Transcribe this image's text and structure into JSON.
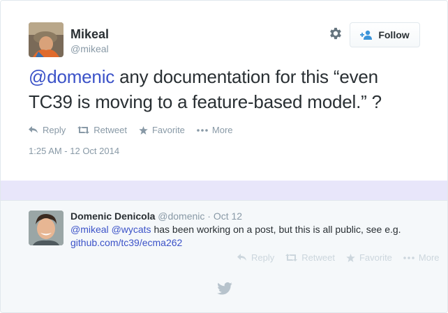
{
  "tweet": {
    "author_name": "Mikeal",
    "author_handle": "@mikeal",
    "follow_label": "Follow",
    "text_mention": "@domenic",
    "text_body": " any documentation for this “even TC39 is moving to a feature-based model.” ?",
    "actions": {
      "reply": "Reply",
      "retweet": "Retweet",
      "favorite": "Favorite",
      "more": "More"
    },
    "timestamp": "1:25 AM - 12 Oct 2014"
  },
  "reply": {
    "author_name": "Domenic Denicola",
    "meta": "@domenic · Oct 12",
    "mention_1": "@mikeal",
    "mention_2": "@wycats",
    "body": " has been working on a post, but this is all public, see e.g.",
    "link": "github.com/tc39/ecma262",
    "actions": {
      "reply": "Reply",
      "retweet": "Retweet",
      "favorite": "Favorite",
      "more": "More"
    }
  },
  "colors": {
    "link": "#3b52c8",
    "muted": "#8899a6",
    "band": "#e8e6fa",
    "reply_bg": "#f5f8fa"
  },
  "icons": [
    "gear-icon",
    "add-user-icon",
    "reply-icon",
    "retweet-icon",
    "star-icon",
    "more-icon",
    "twitter-bird-icon"
  ]
}
